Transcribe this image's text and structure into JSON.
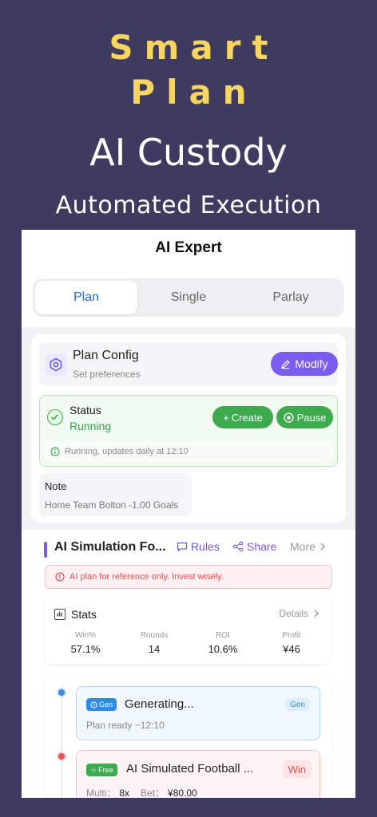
{
  "hero": {
    "title_line1": "Smart",
    "title_line2": "Plan",
    "subtitle": "AI Custody",
    "tagline": "Automated Execution"
  },
  "app": {
    "title": "AI Expert",
    "tabs": [
      {
        "label": "Plan",
        "active": true
      },
      {
        "label": "Single",
        "active": false
      },
      {
        "label": "Parlay",
        "active": false
      }
    ]
  },
  "plan_config": {
    "title": "Plan Config",
    "subtitle": "Set preferences",
    "modify_label": "Modify",
    "icon": "hexagon-settings-icon"
  },
  "status": {
    "title": "Status",
    "value": "Running",
    "create_label": "Create",
    "pause_label": "Pause",
    "info": "Running, updates daily at 12:10"
  },
  "note": {
    "title": "Note",
    "value": "Home Team Bolton -1.00 Goals"
  },
  "section": {
    "title": "AI Simulation Fo...",
    "rules_label": "Rules",
    "share_label": "Share",
    "more_label": "More",
    "warning": "AI plan for reference only. Invest wisely."
  },
  "stats": {
    "title": "Stats",
    "details_label": "Details",
    "items": [
      {
        "label": "Win%",
        "value": "57.1%"
      },
      {
        "label": "Rounds",
        "value": "14"
      },
      {
        "label": "ROI",
        "value": "10.6%"
      },
      {
        "label": "Profit",
        "value": "¥46"
      }
    ]
  },
  "timeline": {
    "generating": {
      "tag": "Gen",
      "title": "Generating...",
      "badge": "Gen",
      "sub": "Plan ready ~12:10"
    },
    "free": {
      "tag": "Free",
      "title": "AI Simulated Football ...",
      "badge": "Win",
      "multi_label": "Multi：",
      "multi_value": "8x",
      "bet_label": "Bet：",
      "bet_value": "¥80.00"
    }
  },
  "colors": {
    "background": "#3f3a60",
    "accent_yellow": "#f6d561",
    "accent_purple": "#7a5cf0",
    "success_green": "#3daa4d",
    "tab_active_blue": "#2e6bc4",
    "danger_red": "#e05555"
  }
}
